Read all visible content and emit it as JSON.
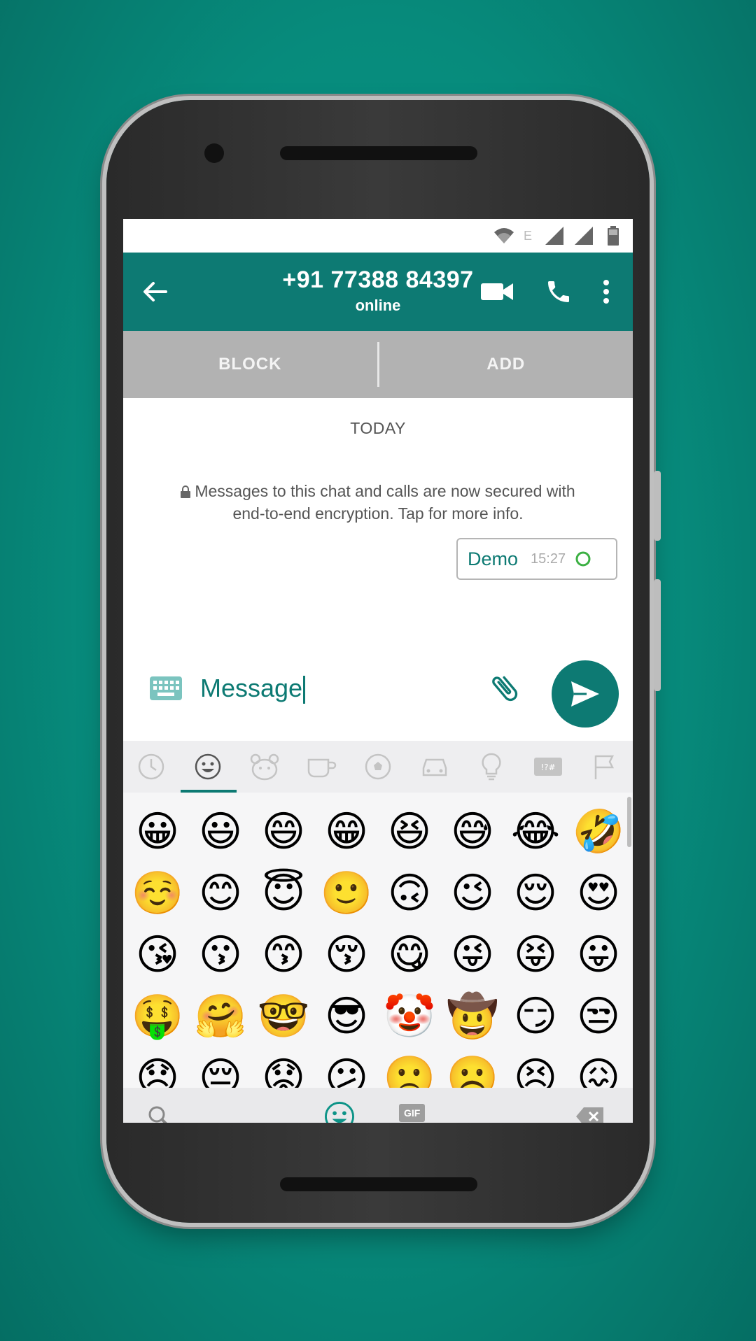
{
  "status_bar": {
    "icons": [
      "wifi-icon",
      "e-network-icon",
      "signal-icon",
      "signal-icon",
      "battery-icon"
    ],
    "network_letter": "E"
  },
  "toolbar": {
    "contact": "+91 77388 84397",
    "status": "online",
    "icons": [
      "back-arrow-icon",
      "video-call-icon",
      "phone-call-icon",
      "more-vert-icon"
    ]
  },
  "action_bar": {
    "block_label": "BLOCK",
    "add_label": "ADD"
  },
  "chat": {
    "date_label": "TODAY",
    "encryption_notice": "Messages to this chat and calls are now secured with end-to-end encryption. Tap for more info.",
    "messages": [
      {
        "text": "Demo",
        "time": "15:27",
        "status": "pending"
      }
    ]
  },
  "input": {
    "value": "Message"
  },
  "emoji_panel": {
    "categories": [
      "recent",
      "smileys",
      "animals",
      "food",
      "activity",
      "travel",
      "objects",
      "symbols",
      "flags"
    ],
    "selected_category": "smileys",
    "rows": [
      [
        "😀",
        "😃",
        "😄",
        "😁",
        "😆",
        "😅",
        "😂",
        "🤣"
      ],
      [
        "☺️",
        "😊",
        "😇",
        "🙂",
        "🙃",
        "😉",
        "😌",
        "😍"
      ],
      [
        "😘",
        "😗",
        "😙",
        "😚",
        "😋",
        "😜",
        "😝",
        "😛"
      ],
      [
        "🤑",
        "🤗",
        "🤓",
        "😎",
        "🤡",
        "🤠",
        "😏",
        "😒"
      ],
      [
        "😞",
        "😔",
        "😟",
        "😕",
        "🙁",
        "☹️",
        "😣",
        "😖"
      ]
    ],
    "bottom_gif_label": "GIF"
  },
  "colors": {
    "background": "#078b7c",
    "toolbar": "#0d7a73",
    "accent": "#0d7a73",
    "action_bar": "#b2b2b2"
  }
}
